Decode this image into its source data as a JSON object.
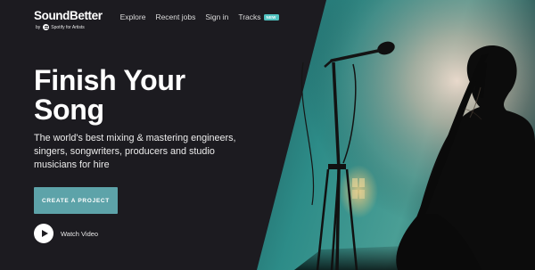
{
  "brand": {
    "logo": "SoundBetter",
    "by": "by",
    "partner": "Spotify for Artists",
    "partner_icon": "spotify-icon"
  },
  "nav": {
    "items": [
      {
        "label": "Explore"
      },
      {
        "label": "Recent jobs"
      },
      {
        "label": "Sign in"
      },
      {
        "label": "Tracks",
        "badge": "NEW"
      }
    ]
  },
  "hero": {
    "headline_line1": "Finish Your",
    "headline_line2": "Song",
    "subtitle": "The world's best mixing & mastering engineers, singers, songwriters, producers and studio musicians for hire",
    "cta_label": "CREATE A PROJECT",
    "watch_label": "Watch Video",
    "watch_icon": "play-icon"
  },
  "colors": {
    "background": "#1c1b20",
    "accent": "#4fc1bf",
    "button": "#5da3a9"
  }
}
